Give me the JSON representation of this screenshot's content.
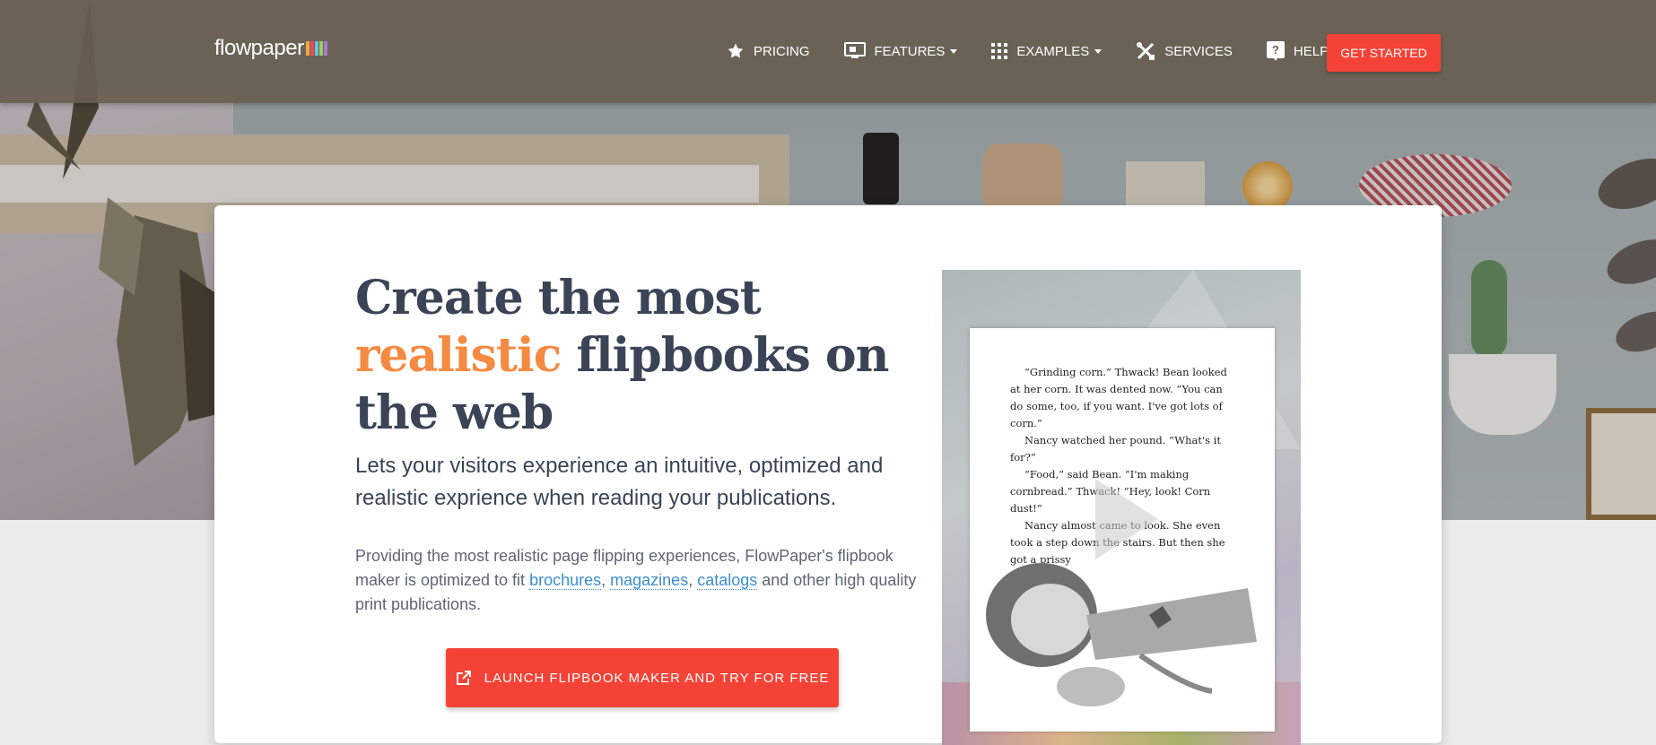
{
  "brand": {
    "logo_text": "flowpaper",
    "logo_bar_colors": [
      "#f4a640",
      "#e94f5a",
      "#6fc1d9",
      "#9acd62",
      "#a37bd1"
    ]
  },
  "nav": {
    "items": [
      {
        "label": "PRICING",
        "icon": "star-icon",
        "has_dropdown": false
      },
      {
        "label": "FEATURES",
        "icon": "desktop-icon",
        "has_dropdown": true
      },
      {
        "label": "EXAMPLES",
        "icon": "apps-grid-icon",
        "has_dropdown": true
      },
      {
        "label": "SERVICES",
        "icon": "tools-icon",
        "has_dropdown": false
      },
      {
        "label": "HELP",
        "icon": "help-icon",
        "has_dropdown": true
      }
    ],
    "cta_label": "GET STARTED"
  },
  "hero": {
    "headline_part1": "Create the most",
    "headline_accent": "realistic",
    "headline_part2": "flipbooks on the web",
    "subhead": "Lets your visitors experience an intuitive, optimized and realistic exprience when reading your publications.",
    "body_prefix": "Providing the most realistic page flipping experiences, FlowPaper's flipbook maker is optimized to fit",
    "link_brochures": "brochures",
    "link_magazines": "magazines",
    "link_catalogs": "catalogs",
    "body_suffix": "and other high quality print publications.",
    "launch_label": "LAUNCH FLIPBOOK MAKER AND TRY FOR FREE"
  },
  "preview": {
    "paragraphs": [
      "“Grinding corn.” Thwack! Bean looked at her corn. It was dented now. “You can do some, too, if you want. I've got lots of corn.”",
      "Nancy watched her pound. “What's it for?”",
      "“Food,” said Bean. “I'm making cornbread.” Thwack! “Hey, look! Corn dust!”",
      "Nancy almost came to look. She even took a step down the stairs. But then she got a prissy"
    ]
  },
  "colors": {
    "accent": "#f58a42",
    "cta": "#f44336",
    "heading": "#3a4456",
    "link": "#3b8ed0",
    "nav_bg": "#685d50"
  }
}
